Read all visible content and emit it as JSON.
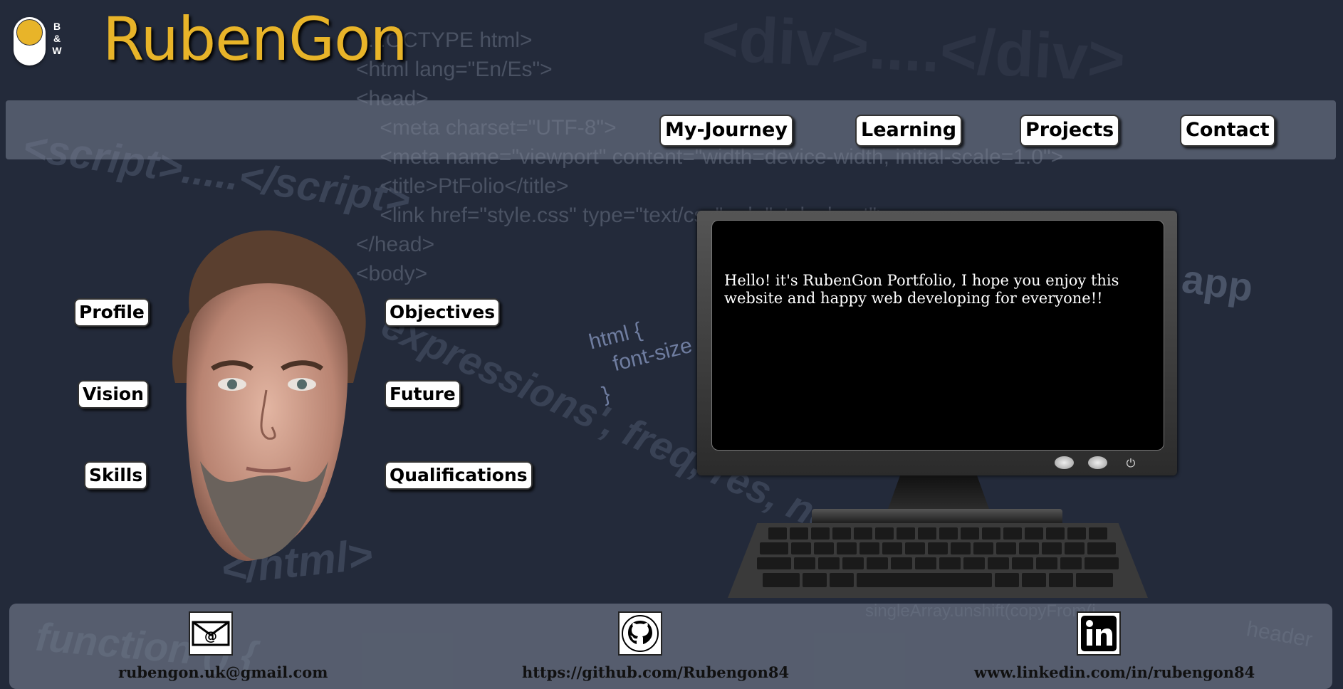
{
  "header": {
    "logo_badge": "B\n&\nW",
    "brand": "RubenGon"
  },
  "nav": {
    "items": [
      "My-Journey",
      "Learning",
      "Projects",
      "Contact"
    ]
  },
  "profile_menu": {
    "profile": "Profile",
    "vision": "Vision",
    "skills": "Skills",
    "objectives": "Objectives",
    "future": "Future",
    "qualifications": "Qualifications"
  },
  "screen": {
    "message": "Hello! it's RubenGon Portfolio, I hope you enjoy this website and happy web developing for everyone!!"
  },
  "footer": {
    "email": "rubengon.uk@gmail.com",
    "github": "https://github.com/Rubengon84",
    "linkedin": "www.linkedin.com/in/rubengon84"
  },
  "colors": {
    "background": "#232a3a",
    "brand": "#e8b429",
    "bar": "#788091"
  },
  "icons": [
    "email-icon",
    "github-icon",
    "linkedin-icon",
    "power-icon"
  ]
}
